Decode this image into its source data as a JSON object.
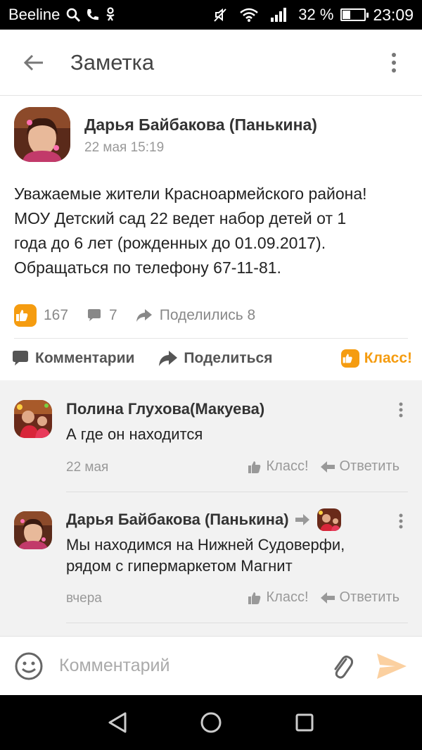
{
  "status_bar": {
    "carrier": "Beeline",
    "battery_percent": "32 %",
    "battery_level": 0.32,
    "time": "23:09",
    "icons": [
      "search-icon",
      "phone-icon",
      "odnoklassniki-icon",
      "mute-icon",
      "wifi-icon",
      "signal-icon",
      "battery-icon"
    ]
  },
  "app_bar": {
    "title": "Заметка",
    "back_icon": "arrow-left-icon",
    "more_icon": "more-vertical-icon"
  },
  "post": {
    "author": "Дарья Байбакова (Панькина)",
    "date": "22 мая 15:19",
    "text_lines": [
      "Уважаемые жители Красноармейского района!",
      "МОУ Детский сад 22 ведет набор детей от 1",
      "года до 6 лет (рожденных до 01.09.2017).",
      "Обращаться по телефону 67-11-81."
    ],
    "stats": {
      "likes": "167",
      "comments": "7",
      "shares": "Поделились 8"
    },
    "actions": {
      "comment": "Комментарии",
      "share": "Поделиться",
      "klass": "Класс!"
    }
  },
  "comments": [
    {
      "author": "Полина Глухова(Макуева)",
      "text_lines": [
        "А где он находится"
      ],
      "date": "22 мая",
      "like_label": "Класс!",
      "reply_label": "Ответить"
    },
    {
      "author": "Дарья Байбакова (Панькина)",
      "text_lines": [
        "Мы находимся на Нижней Судоверфи,",
        "рядом с гипермаркетом Магнит"
      ],
      "date": "вчера",
      "like_label": "Класс!",
      "reply_label": "Ответить"
    }
  ],
  "input_bar": {
    "placeholder": "Комментарий",
    "emoji_icon": "smiley-icon",
    "attach_icon": "paperclip-icon",
    "send_icon": "send-icon"
  },
  "nav_bar": {
    "icons": [
      "back-triangle-icon",
      "home-circle-icon",
      "recents-square-icon"
    ]
  },
  "colors": {
    "accent": "#f59c10",
    "status_bar": "#000000",
    "comments_bg": "#f2f2f2",
    "muted_text": "#999999"
  }
}
